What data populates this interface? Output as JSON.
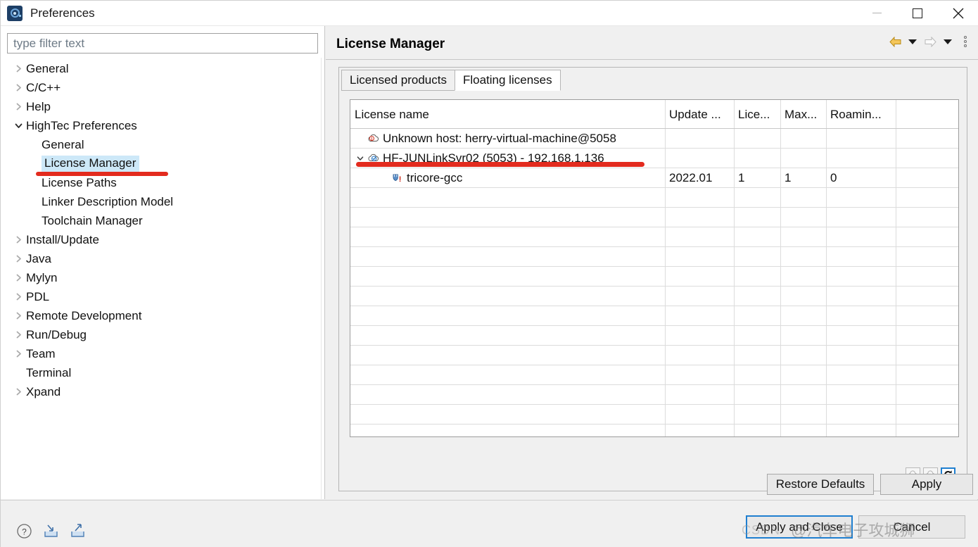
{
  "window": {
    "title": "Preferences",
    "app_icon": "preferences-app-icon",
    "minimize_label": "Minimize",
    "maximize_label": "Maximize",
    "close_label": "Close"
  },
  "sidebar": {
    "filter": {
      "value": "",
      "placeholder": "type filter text"
    },
    "items": [
      {
        "label": "General",
        "level": 0,
        "expandable": true,
        "expanded": false,
        "selected": false
      },
      {
        "label": "C/C++",
        "level": 0,
        "expandable": true,
        "expanded": false,
        "selected": false
      },
      {
        "label": "Help",
        "level": 0,
        "expandable": true,
        "expanded": false,
        "selected": false
      },
      {
        "label": "HighTec Preferences",
        "level": 0,
        "expandable": true,
        "expanded": true,
        "selected": false
      },
      {
        "label": "General",
        "level": 1,
        "expandable": false,
        "expanded": false,
        "selected": false
      },
      {
        "label": "License Manager",
        "level": 1,
        "expandable": false,
        "expanded": false,
        "selected": true
      },
      {
        "label": "License Paths",
        "level": 1,
        "expandable": false,
        "expanded": false,
        "selected": false
      },
      {
        "label": "Linker Description Model",
        "level": 1,
        "expandable": false,
        "expanded": false,
        "selected": false
      },
      {
        "label": "Toolchain Manager",
        "level": 1,
        "expandable": false,
        "expanded": false,
        "selected": false
      },
      {
        "label": "Install/Update",
        "level": 0,
        "expandable": true,
        "expanded": false,
        "selected": false
      },
      {
        "label": "Java",
        "level": 0,
        "expandable": true,
        "expanded": false,
        "selected": false
      },
      {
        "label": "Mylyn",
        "level": 0,
        "expandable": true,
        "expanded": false,
        "selected": false
      },
      {
        "label": "PDL",
        "level": 0,
        "expandable": true,
        "expanded": false,
        "selected": false
      },
      {
        "label": "Remote Development",
        "level": 0,
        "expandable": true,
        "expanded": false,
        "selected": false
      },
      {
        "label": "Run/Debug",
        "level": 0,
        "expandable": true,
        "expanded": false,
        "selected": false
      },
      {
        "label": "Team",
        "level": 0,
        "expandable": true,
        "expanded": false,
        "selected": false
      },
      {
        "label": "Terminal",
        "level": 0,
        "expandable": false,
        "expanded": false,
        "selected": false
      },
      {
        "label": "Xpand",
        "level": 0,
        "expandable": true,
        "expanded": false,
        "selected": false
      }
    ]
  },
  "main": {
    "title": "License Manager",
    "nav": {
      "back_icon": "back-arrow-icon",
      "back_menu_icon": "back-dropdown-icon",
      "forward_icon": "forward-arrow-icon",
      "forward_menu_icon": "forward-dropdown-icon",
      "view_menu_icon": "view-menu-icon"
    },
    "tabs": [
      {
        "label": "Licensed products",
        "active": false
      },
      {
        "label": "Floating licenses",
        "active": true
      }
    ],
    "table": {
      "columns": [
        "License name",
        "Update ...",
        "Lice...",
        "Max...",
        "Roamin...",
        ""
      ],
      "rows": [
        {
          "icon": "cloud-error-icon",
          "name": "Unknown host: herry-virtual-machine@5058",
          "indent": 1,
          "caret": "",
          "update": "",
          "licenses": "",
          "max": "",
          "roaming": ""
        },
        {
          "icon": "cloud-ok-icon",
          "name": "HF-JUNLinkSvr02 (5053) - 192.168.1.136",
          "indent": 0,
          "caret": "expanded",
          "update": "",
          "licenses": "",
          "max": "",
          "roaming": ""
        },
        {
          "icon": "license-key-warning-icon",
          "name": "tricore-gcc",
          "indent": 2,
          "caret": "",
          "update": "2022.01",
          "licenses": "1",
          "max": "1",
          "roaming": "0"
        }
      ]
    },
    "table_buttons": [
      {
        "name": "checkout-license-button",
        "icon": "cloud-download-icon",
        "enabled": false
      },
      {
        "name": "checkin-license-button",
        "icon": "cloud-upload-icon",
        "enabled": false
      },
      {
        "name": "refresh-button",
        "icon": "refresh-icon",
        "enabled": true
      }
    ],
    "restore_defaults_label": "Restore Defaults",
    "apply_label": "Apply"
  },
  "footer": {
    "help_icon": "help-icon",
    "import_icon": "import-icon",
    "export_icon": "export-icon",
    "apply_and_close_label": "Apply and Close",
    "cancel_label": "Cancel"
  },
  "watermark": {
    "text": "@汽车电子攻城狮",
    "site": "CSDN"
  },
  "colors": {
    "selection": "#cde8f8",
    "accent": "#1f7fd0",
    "annotation": "#e32b1e",
    "titlebar": "#ffffff",
    "chrome": "#f0f0f0"
  }
}
